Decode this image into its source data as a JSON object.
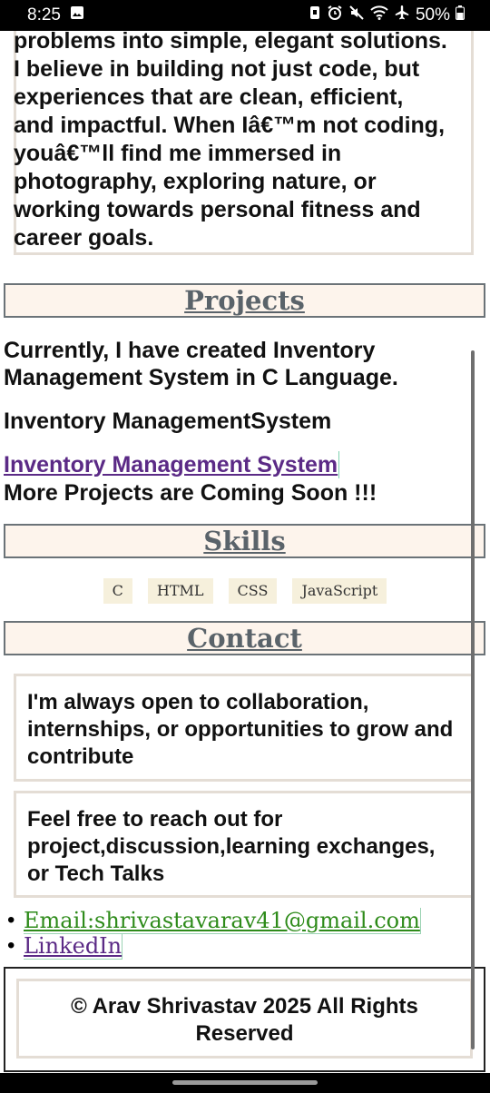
{
  "status_bar": {
    "time": "8:25",
    "battery": "50%",
    "icons": [
      "image-icon",
      "screenshot-icon",
      "alarm-icon",
      "mute-icon",
      "wifi-icon",
      "airplane-icon",
      "battery-icon"
    ]
  },
  "about": {
    "text": "problems into simple, elegant solutions. I believe in building not just code, but experiences that are clean, efficient, and impactful. When Iâ€™m not coding, youâ€™ll find me immersed in photography, exploring nature, or working towards personal fitness and career goals."
  },
  "projects": {
    "heading": "Projects",
    "intro": "Currently, I have created Inventory Management System in C Language.",
    "project_title": "Inventory ManagementSystem",
    "project_link": "Inventory Management System",
    "more": "More Projects are Coming Soon !!!"
  },
  "skills": {
    "heading": "Skills",
    "items": [
      "C",
      "HTML",
      "CSS",
      "JavaScript"
    ]
  },
  "contact": {
    "heading": "Contact",
    "message1": "I'm always open to collaboration, internships, or opportunities to grow and contribute",
    "message2": "Feel free to reach out for project,discussion,learning exchanges, or Tech Talks",
    "email_link": "Email:shrivastavarav41@gmail.com",
    "linkedin_link": "LinkedIn"
  },
  "footer": {
    "text": "© Arav Shrivastav 2025 All Rights Reserved"
  },
  "colors": {
    "heading_bg": "#fdf4ec",
    "heading_text": "#5a636a",
    "skill_bg": "#f6f0dc",
    "visited_link": "#5b2a86",
    "email_link": "#2e8b1a"
  }
}
